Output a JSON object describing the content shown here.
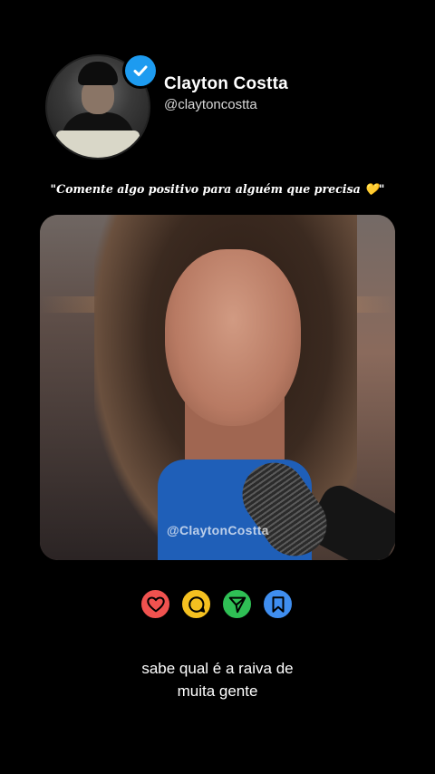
{
  "profile": {
    "name": "Clayton Costta",
    "handle": "@claytoncostta"
  },
  "post": {
    "quote": "\"Comente algo positivo para alguém que precisa 💛\"",
    "watermark": "@ClaytonCostta",
    "caption_line1": "sabe qual é a raiva de",
    "caption_line2": "muita gente"
  },
  "actions": [
    {
      "icon": "heart-icon",
      "color": "#f0524f"
    },
    {
      "icon": "comment-icon",
      "color": "#f4c020"
    },
    {
      "icon": "send-icon",
      "color": "#2fbf55"
    },
    {
      "icon": "bookmark-icon",
      "color": "#3f8ef0"
    }
  ],
  "colors": {
    "verified": "#1d9bf0",
    "background": "#000000"
  }
}
